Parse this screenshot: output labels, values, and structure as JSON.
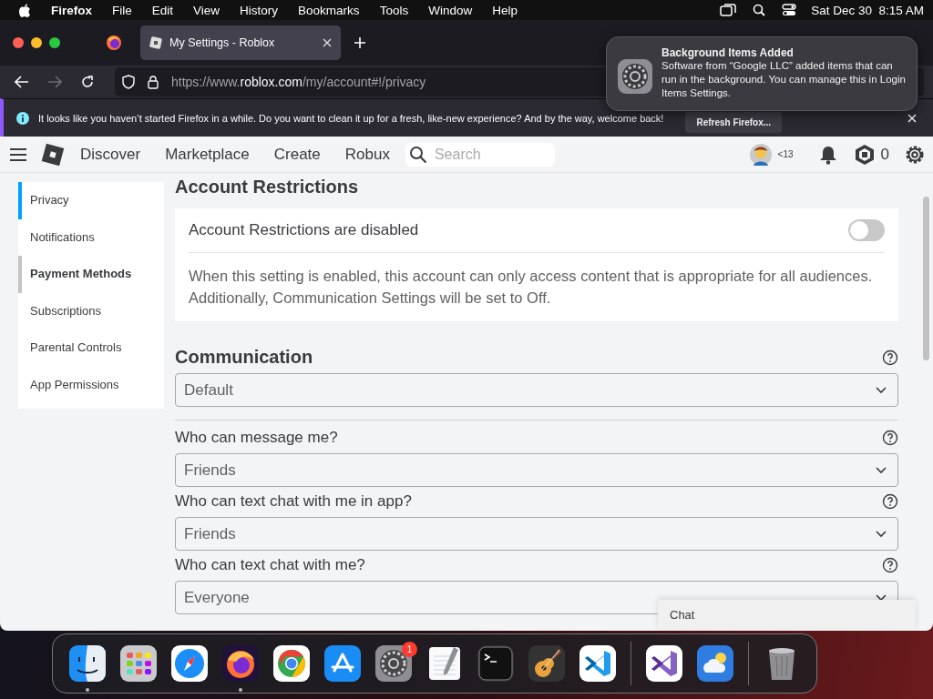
{
  "menubar": {
    "app": "Firefox",
    "menus": [
      "File",
      "Edit",
      "View",
      "History",
      "Bookmarks",
      "Tools",
      "Window",
      "Help"
    ],
    "clock": "Sat Dec 30  8:15 AM"
  },
  "browser": {
    "tabs": [
      {
        "title": "My Settings - Roblox",
        "selected": true
      }
    ],
    "url": "https://www.**roblox.com**/my/account#!/privacy",
    "infobar": {
      "message": "It looks like you haven’t started Firefox in a while. Do you want to clean it up for a fresh, like-new experience? And by the way, welcome back!",
      "button": "Refresh Firefox..."
    }
  },
  "notification": {
    "title": "Background Items Added",
    "body": "Software from “Google LLC” added items that can run in the background. You can manage this in Login Items Settings."
  },
  "roblox_nav": {
    "links": [
      "Discover",
      "Marketplace",
      "Create",
      "Robux"
    ],
    "search": {
      "placeholder": "Search"
    },
    "age": "<13",
    "robux": "0"
  },
  "sidebar": {
    "items": [
      {
        "label": "Privacy",
        "selected": true,
        "hovered": false
      },
      {
        "label": "Notifications",
        "selected": false,
        "hovered": false
      },
      {
        "label": "Payment Methods",
        "selected": false,
        "hovered": true
      },
      {
        "label": "Subscriptions",
        "selected": false,
        "hovered": false
      },
      {
        "label": "Parental Controls",
        "selected": false,
        "hovered": false
      },
      {
        "label": "App Permissions",
        "selected": false,
        "hovered": false
      }
    ]
  },
  "account_restrictions": {
    "heading": "Account Restrictions",
    "toggle_label": "Account Restrictions are disabled",
    "on": false,
    "description": "When this setting is enabled, this account can only access content that is appropriate for all audiences. Additionally, Communication Settings will be set to Off."
  },
  "communication": {
    "heading": "Communication",
    "preset": "Default",
    "settings": [
      {
        "question": "Who can message me?",
        "value": "Friends"
      },
      {
        "question": "Who can text chat with me in app?",
        "value": "Friends"
      },
      {
        "question": "Who can text chat with me?",
        "value": "Everyone"
      }
    ]
  },
  "chat": "Chat",
  "dock": {
    "items": [
      {
        "kind": "finder",
        "running": true
      },
      {
        "kind": "launchpad",
        "running": false
      },
      {
        "kind": "safari",
        "running": false
      },
      {
        "kind": "firefox",
        "running": true
      },
      {
        "kind": "chrome",
        "running": false
      },
      {
        "kind": "appstore",
        "running": false
      },
      {
        "kind": "settings",
        "running": false,
        "badge": "1"
      },
      {
        "kind": "textedit",
        "running": false
      },
      {
        "kind": "terminal",
        "running": false
      },
      {
        "kind": "guitar",
        "running": false
      },
      {
        "kind": "vscode",
        "running": false
      },
      {
        "kind": "divider"
      },
      {
        "kind": "visualstudio",
        "running": false
      },
      {
        "kind": "weather",
        "running": false
      },
      {
        "kind": "divider"
      },
      {
        "kind": "trash",
        "running": false
      }
    ]
  }
}
